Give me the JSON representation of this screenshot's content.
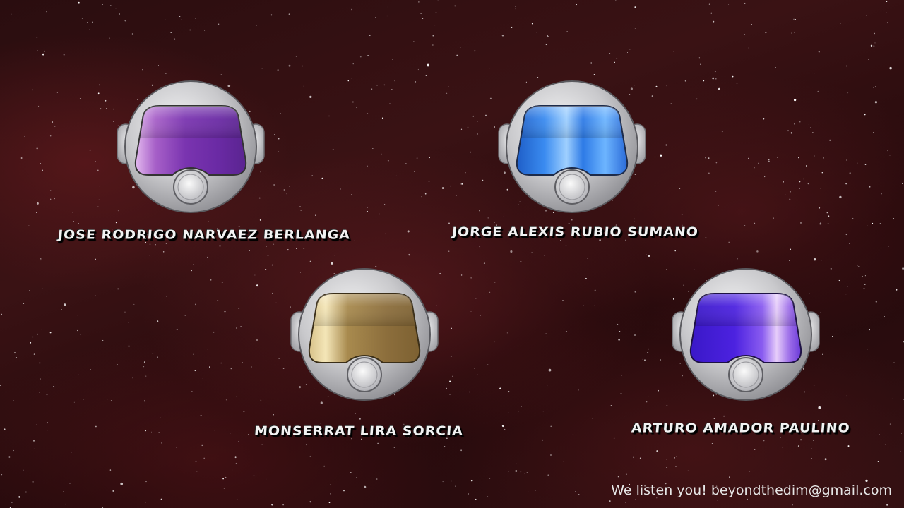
{
  "team": {
    "members": [
      {
        "name": "Jose Rodrigo Narvaez Berlanga",
        "visor_color": "purple"
      },
      {
        "name": "Jorge Alexis Rubio Sumano",
        "visor_color": "blue"
      },
      {
        "name": "Monserrat Lira Sorcia",
        "visor_color": "gold"
      },
      {
        "name": "Arturo Amador Paulino",
        "visor_color": "violet"
      }
    ]
  },
  "footer": {
    "contact": "We listen you! beyondthedim@gmail.com"
  },
  "colors": {
    "background": "#2a0d0f",
    "purple_visor": "#7a3cb0",
    "blue_visor": "#2f7fe0",
    "gold_visor": "#b89a5a",
    "violet_visor": "#5a2ad8",
    "helmet_silver": "#c9c9cc",
    "text": "#f2f2f2"
  }
}
